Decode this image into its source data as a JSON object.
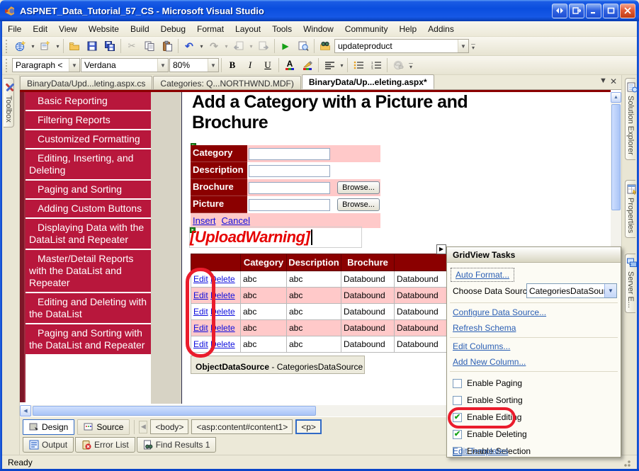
{
  "window": {
    "title": "ASPNET_Data_Tutorial_57_CS - Microsoft Visual Studio"
  },
  "menu": {
    "items": [
      "File",
      "Edit",
      "View",
      "Website",
      "Build",
      "Debug",
      "Format",
      "Layout",
      "Tools",
      "Window",
      "Community",
      "Help",
      "Addins"
    ]
  },
  "toolbar1": {
    "command_box": "updateproduct"
  },
  "toolbar2": {
    "style": "Paragraph <",
    "font": "Verdana",
    "zoom": "80%",
    "bold": "B",
    "italic": "I",
    "underline": "U"
  },
  "editor_tabs": [
    "BinaryData/Upd...leting.aspx.cs",
    "Categories: Q...NORTHWND.MDF)",
    "BinaryData/Up...eleting.aspx*"
  ],
  "left_strip": {
    "toolbox": "Toolbox"
  },
  "right_strip": {
    "tabs": [
      "Solution Explorer",
      "Properties",
      "Server E..."
    ]
  },
  "sidebar": {
    "items": [
      "Basic Reporting",
      "Filtering Reports",
      "Customized Formatting",
      "Editing, Inserting, and Deleting",
      "Paging and Sorting",
      "Adding Custom Buttons",
      "Displaying Data with the DataList and Repeater",
      "Master/Detail Reports with the DataList and Repeater",
      "Editing and Deleting with the DataList",
      "Paging and Sorting with the DataList and Repeater"
    ]
  },
  "page": {
    "heading": "Add a Category with a Picture and Brochure",
    "form": {
      "labels": [
        "Category",
        "Description",
        "Brochure",
        "Picture"
      ],
      "browse": "Browse...",
      "insert": "Insert",
      "cancel": "Cancel"
    },
    "upload_warning": "[UploadWarning]",
    "grid": {
      "headers": [
        "",
        "Category",
        "Description",
        "Brochure",
        ""
      ],
      "rows": [
        {
          "edit": "Edit",
          "del": "Delete",
          "category": "abc",
          "description": "abc",
          "brochure": "Databound",
          "picture": "Databound"
        },
        {
          "edit": "Edit",
          "del": "Delete",
          "category": "abc",
          "description": "abc",
          "brochure": "Databound",
          "picture": "Databound"
        },
        {
          "edit": "Edit",
          "del": "Delete",
          "category": "abc",
          "description": "abc",
          "brochure": "Databound",
          "picture": "Databound"
        },
        {
          "edit": "Edit",
          "del": "Delete",
          "category": "abc",
          "description": "abc",
          "brochure": "Databound",
          "picture": "Databound"
        },
        {
          "edit": "Edit",
          "del": "Delete",
          "category": "abc",
          "description": "abc",
          "brochure": "Databound",
          "picture": "Databound"
        }
      ]
    },
    "datasource": {
      "name": "ObjectDataSource",
      "suffix": " - CategoriesDataSource"
    }
  },
  "popup": {
    "title": "GridView Tasks",
    "auto_format": "Auto Format...",
    "choose_data_source_label": "Choose Data Source:",
    "choose_data_source_value": "CategoriesDataSource",
    "configure": "Configure Data Source...",
    "refresh": "Refresh Schema",
    "edit_columns": "Edit Columns...",
    "add_new_column": "Add New Column...",
    "checkboxes": [
      {
        "label": "Enable Paging",
        "checked": false
      },
      {
        "label": "Enable Sorting",
        "checked": false
      },
      {
        "label": "Enable Editing",
        "checked": true,
        "circled": true
      },
      {
        "label": "Enable Deleting",
        "checked": true
      },
      {
        "label": "Enable Selection",
        "checked": false
      }
    ],
    "edit_templates": "Edit Templates"
  },
  "bottom_bar": {
    "design": "Design",
    "source": "Source",
    "tags": [
      "<body>",
      "<asp:content#content1>",
      "<p>"
    ]
  },
  "panel_tabs": [
    "Output",
    "Error List",
    "Find Results 1"
  ],
  "status": {
    "text": "Ready"
  },
  "colors": {
    "sidebar_red": "#b8173c",
    "header_maroon": "#8b0000",
    "row_pink": "#ffc9c9",
    "page_link_blue": "#0e0edd",
    "vs_link_blue": "#2b5fb4",
    "annotation_red": "#ea1c2c",
    "check_green": "#17a317"
  }
}
